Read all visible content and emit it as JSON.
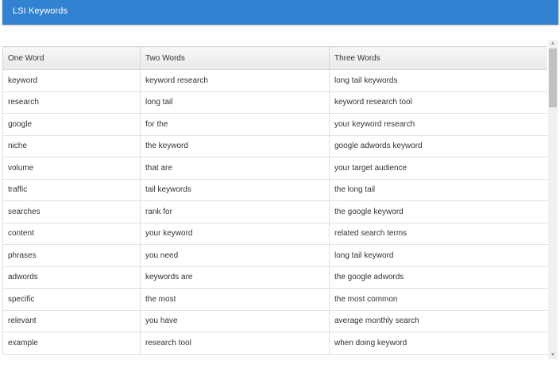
{
  "panel": {
    "title": "LSI Keywords"
  },
  "table": {
    "headers": [
      "One Word",
      "Two Words",
      "Three Words"
    ],
    "rows": [
      [
        "keyword",
        "keyword research",
        "long tail keywords"
      ],
      [
        "research",
        "long tail",
        "keyword research tool"
      ],
      [
        "google",
        "for the",
        "your keyword research"
      ],
      [
        "niche",
        "the keyword",
        "google adwords keyword"
      ],
      [
        "volume",
        "that are",
        "your target audience"
      ],
      [
        "traffic",
        "tail keywords",
        "the long tail"
      ],
      [
        "searches",
        "rank for",
        "the google keyword"
      ],
      [
        "content",
        "your keyword",
        "related search terms"
      ],
      [
        "phrases",
        "you need",
        "long tail keyword"
      ],
      [
        "adwords",
        "keywords are",
        "the google adwords"
      ],
      [
        "specific",
        "the most",
        "the most common"
      ],
      [
        "relevant",
        "you have",
        "average monthly search"
      ],
      [
        "example",
        "research tool",
        "when doing keyword"
      ]
    ]
  },
  "scrollbar": {
    "up_icon": "chevron-up-icon",
    "down_icon": "chevron-down-icon",
    "up_glyph": "▲",
    "down_glyph": "▼"
  },
  "colors": {
    "header_bg": "#3282d2",
    "header_text": "#ffffff",
    "table_header_bg": "#eeeeee",
    "border": "#e1e1e1"
  }
}
